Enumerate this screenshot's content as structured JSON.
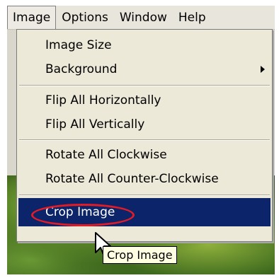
{
  "menubar": {
    "items": [
      "Image",
      "Options",
      "Window",
      "Help"
    ]
  },
  "menu": {
    "items": [
      {
        "label": "Image Size"
      },
      {
        "label": "Background",
        "submenu": true
      },
      {
        "label": "Flip All Horizontally"
      },
      {
        "label": "Flip All Vertically"
      },
      {
        "label": "Rotate All Clockwise"
      },
      {
        "label": "Rotate All Counter-Clockwise"
      },
      {
        "label": "Crop Image",
        "highlighted": true
      }
    ]
  },
  "tooltip": "Crop Image",
  "colors": {
    "highlight": "#0b246a",
    "annotation_circle": "#e21c24",
    "menu_bg": "#ece9d8",
    "tooltip_bg": "#ffffe1"
  },
  "icons": {
    "submenu": "chevron-right-icon",
    "cursor": "mouse-cursor-icon"
  }
}
